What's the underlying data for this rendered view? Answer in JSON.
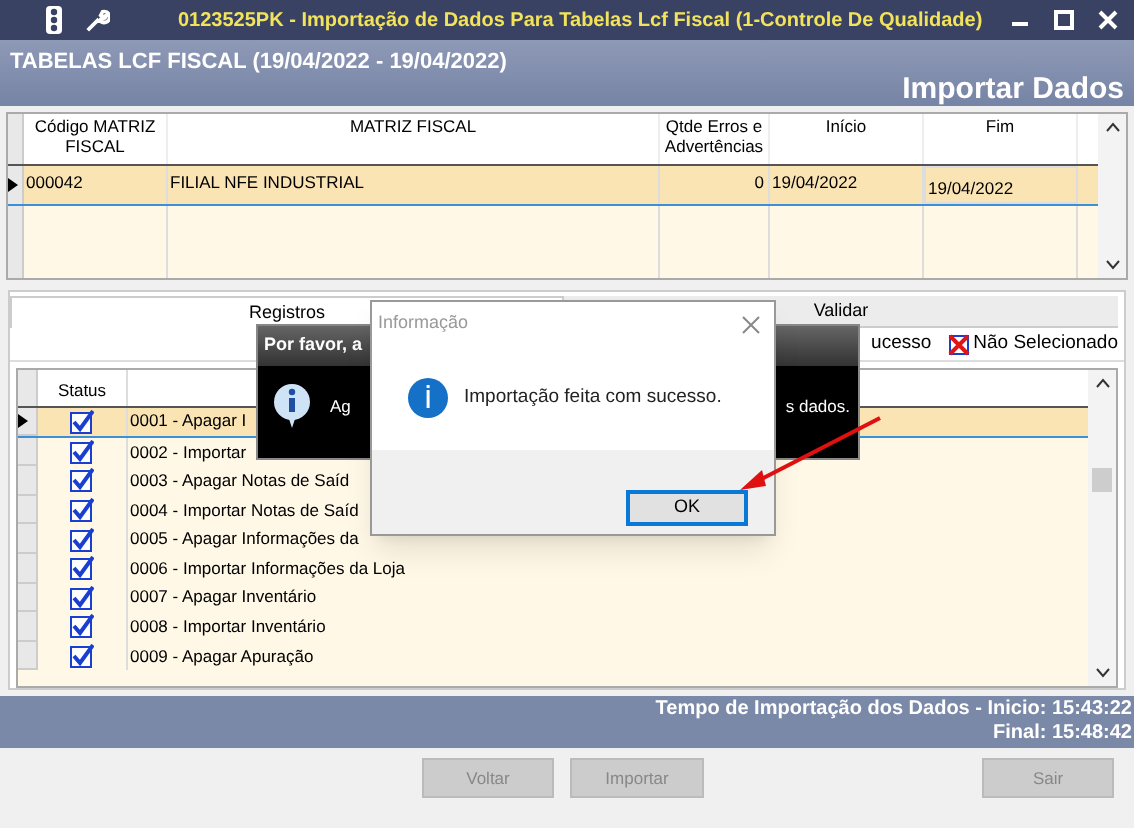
{
  "window": {
    "title": "0123525PK - Importação de Dados Para Tabelas Lcf Fiscal (1-Controle De Qualidade)"
  },
  "header": {
    "title": "TABELAS LCF FISCAL (19/04/2022 - 19/04/2022)",
    "subtitle": "Importar Dados"
  },
  "matrix_table": {
    "columns": [
      "Código MATRIZ FISCAL",
      "MATRIZ FISCAL",
      "Qtde Erros e Advertências",
      "Início",
      "Fim"
    ],
    "rows": [
      {
        "cells": [
          "000042",
          "FILIAL NFE INDUSTRIAL",
          "0",
          "19/04/2022",
          "19/04/2022"
        ],
        "selected": true
      }
    ]
  },
  "tabs": [
    {
      "label": "Registros",
      "selected": true
    },
    {
      "label": "Validar",
      "selected": false
    }
  ],
  "legend": [
    {
      "label": "ucesso",
      "kind": "text"
    },
    {
      "label": "Não Selecionado",
      "kind": "cross"
    }
  ],
  "records_table": {
    "columns": [
      "Status"
    ],
    "rows": [
      {
        "label": "0001 - Apagar I",
        "checked": true,
        "selected": true
      },
      {
        "label": "0002 - Importar",
        "checked": true,
        "selected": false
      },
      {
        "label": "0003 - Apagar Notas de Saíd",
        "checked": true,
        "selected": false
      },
      {
        "label": "0004 - Importar Notas de Saíd",
        "checked": true,
        "selected": false
      },
      {
        "label": "0005 - Apagar Informações da",
        "checked": true,
        "selected": false
      },
      {
        "label": "0006 - Importar Informações da Loja",
        "checked": true,
        "selected": false
      },
      {
        "label": "0007 - Apagar Inventário",
        "checked": true,
        "selected": false
      },
      {
        "label": "0008 - Importar Inventário",
        "checked": true,
        "selected": false
      },
      {
        "label": "0009 - Apagar Apuração",
        "checked": true,
        "selected": false
      }
    ]
  },
  "status_band": {
    "line_1": "Tempo de Importação dos Dados - Inicio: 15:43:22",
    "line_2": "Final: 15:48:42"
  },
  "buttons": [
    {
      "label": "Voltar",
      "disabled": true
    },
    {
      "label": "Importar",
      "disabled": true
    },
    {
      "label": "Sair",
      "disabled": true
    }
  ],
  "back_dialog": {
    "title": "Por favor, a",
    "text_left": "Ag",
    "text_right": "s dados."
  },
  "dialog": {
    "title": "Informação",
    "message": "Importação feita com sucesso.",
    "button": "OK"
  }
}
